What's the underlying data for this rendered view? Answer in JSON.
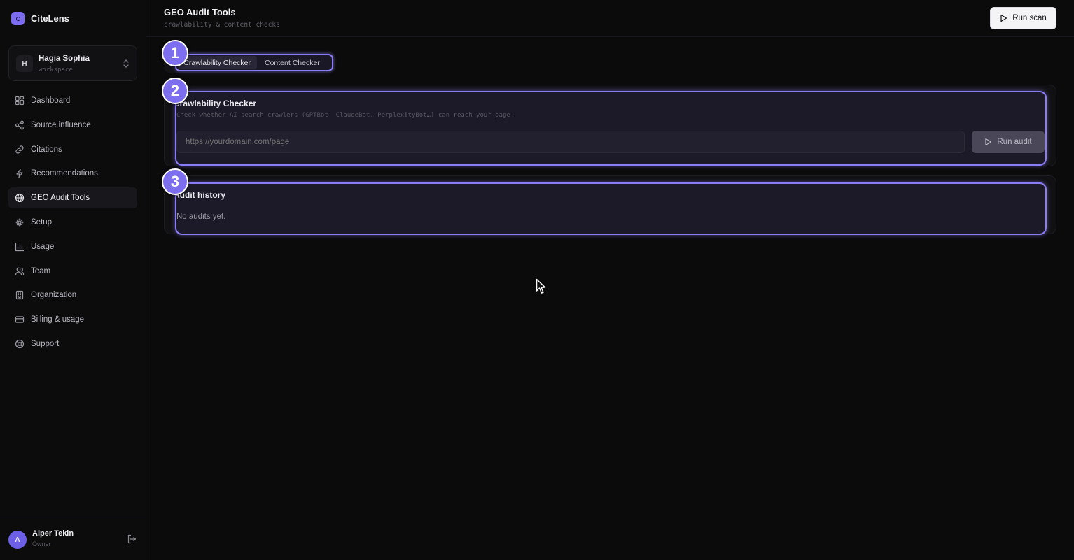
{
  "app": {
    "name": "CiteLens"
  },
  "workspace": {
    "initial": "H",
    "name": "Hagia Sophia",
    "sub": "workspace"
  },
  "nav": [
    {
      "label": "Dashboard",
      "icon": "dashboard-icon"
    },
    {
      "label": "Source influence",
      "icon": "share-icon"
    },
    {
      "label": "Citations",
      "icon": "link-icon"
    },
    {
      "label": "Recommendations",
      "icon": "lightning-icon"
    },
    {
      "label": "GEO Audit Tools",
      "icon": "globe-icon",
      "active": true
    },
    {
      "label": "Setup",
      "icon": "gear-icon"
    },
    {
      "label": "Usage",
      "icon": "bar-chart-icon"
    },
    {
      "label": "Team",
      "icon": "users-icon"
    },
    {
      "label": "Organization",
      "icon": "building-icon"
    },
    {
      "label": "Billing & usage",
      "icon": "credit-card-icon"
    },
    {
      "label": "Support",
      "icon": "lifebuoy-icon"
    }
  ],
  "user": {
    "initial": "A",
    "name": "Alper Tekin",
    "role": "Owner"
  },
  "header": {
    "title": "GEO Audit Tools",
    "subtitle": "crawlability & content checks",
    "run_scan_label": "Run scan"
  },
  "tabs": [
    {
      "label": "Crawlability Checker",
      "active": true
    },
    {
      "label": "Content Checker",
      "active": false
    }
  ],
  "checker": {
    "title": "Crawlability Checker",
    "description": "Check whether AI search crawlers (GPTBot, ClaudeBot, PerplexityBot…) can reach your page.",
    "url_placeholder": "https://yourdomain.com/page",
    "run_audit_label": "Run audit"
  },
  "history": {
    "title": "Audit history",
    "empty_text": "No audits yet."
  },
  "badges": [
    "1",
    "2",
    "3"
  ],
  "colors": {
    "accent": "#8a7cf7",
    "background": "#0b0b0c",
    "badge": "#7d6ef0"
  }
}
